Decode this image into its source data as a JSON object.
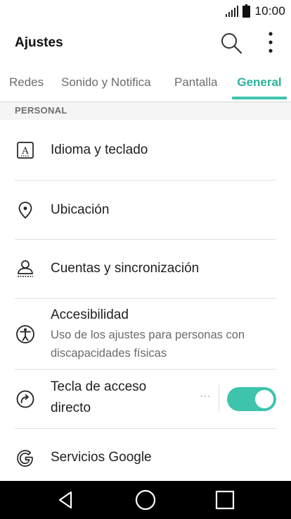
{
  "status_bar": {
    "time": "10:00"
  },
  "app_bar": {
    "title": "Ajustes",
    "search_icon": "search-icon",
    "more_icon": "more-vertical-icon"
  },
  "tabs": [
    {
      "label": "Redes",
      "selected": false
    },
    {
      "label": "Sonido y Notifica",
      "selected": false
    },
    {
      "label": "Pantalla",
      "selected": false
    },
    {
      "label": "General",
      "selected": true
    }
  ],
  "accent_color": "#3ec4ad",
  "section": {
    "title": "PERSONAL"
  },
  "items": [
    {
      "label": "Idioma y teclado",
      "icon": "language-icon"
    },
    {
      "label": "Ubicación",
      "icon": "location-pin-icon"
    },
    {
      "label": "Cuentas y sincronización",
      "icon": "accounts-icon"
    },
    {
      "label": "Accesibilidad",
      "subtitle": "Uso de los ajustes para personas con discapacidades físicas",
      "icon": "accessibility-icon"
    },
    {
      "label_line1": "Tecla de acceso",
      "label_line2": "directo",
      "icon": "shortcut-key-icon",
      "toggle_on": true,
      "more": "⋯"
    },
    {
      "label": "Servicios Google",
      "icon": "google-icon"
    }
  ],
  "nav_bar": {
    "back_icon": "back-icon",
    "home_icon": "home-icon",
    "recents_icon": "recents-icon"
  }
}
